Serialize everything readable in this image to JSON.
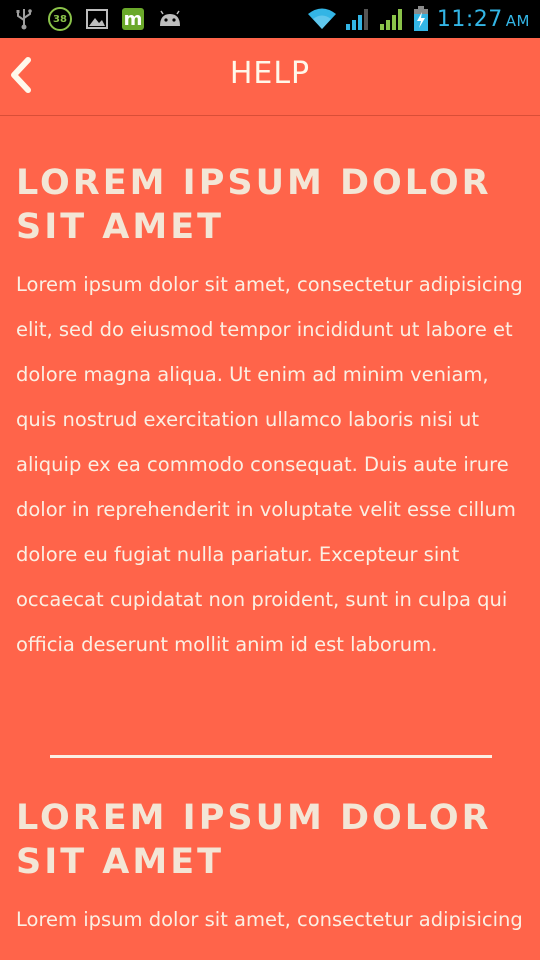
{
  "status_bar": {
    "notification_badge": "38",
    "m_icon_text": "m",
    "time": "11:27",
    "ampm": "AM",
    "accent_color": "#33B5E5"
  },
  "action_bar": {
    "title": "HELP",
    "back_icon": "chevron-left-icon"
  },
  "sections": [
    {
      "title": "LOREM IPSUM DOLOR SIT AMET",
      "body": "Lorem ipsum dolor sit amet, consectetur adipisicing elit, sed do eiusmod tempor incididunt ut labore et dolore magna aliqua. Ut enim ad minim veniam, quis nostrud exercitation ullamco laboris nisi ut aliquip ex ea commodo consequat. Duis aute irure dolor in reprehenderit in voluptate velit esse cillum dolore eu fugiat nulla pariatur. Excepteur sint occaecat cupidatat non proident, sunt in culpa qui officia deserunt mollit anim id est laborum."
    },
    {
      "title": "LOREM IPSUM DOLOR SIT AMET",
      "body": "Lorem ipsum dolor sit amet, consectetur adipisicing"
    }
  ],
  "colors": {
    "background": "#FF644A",
    "text": "#FBEFE3"
  }
}
